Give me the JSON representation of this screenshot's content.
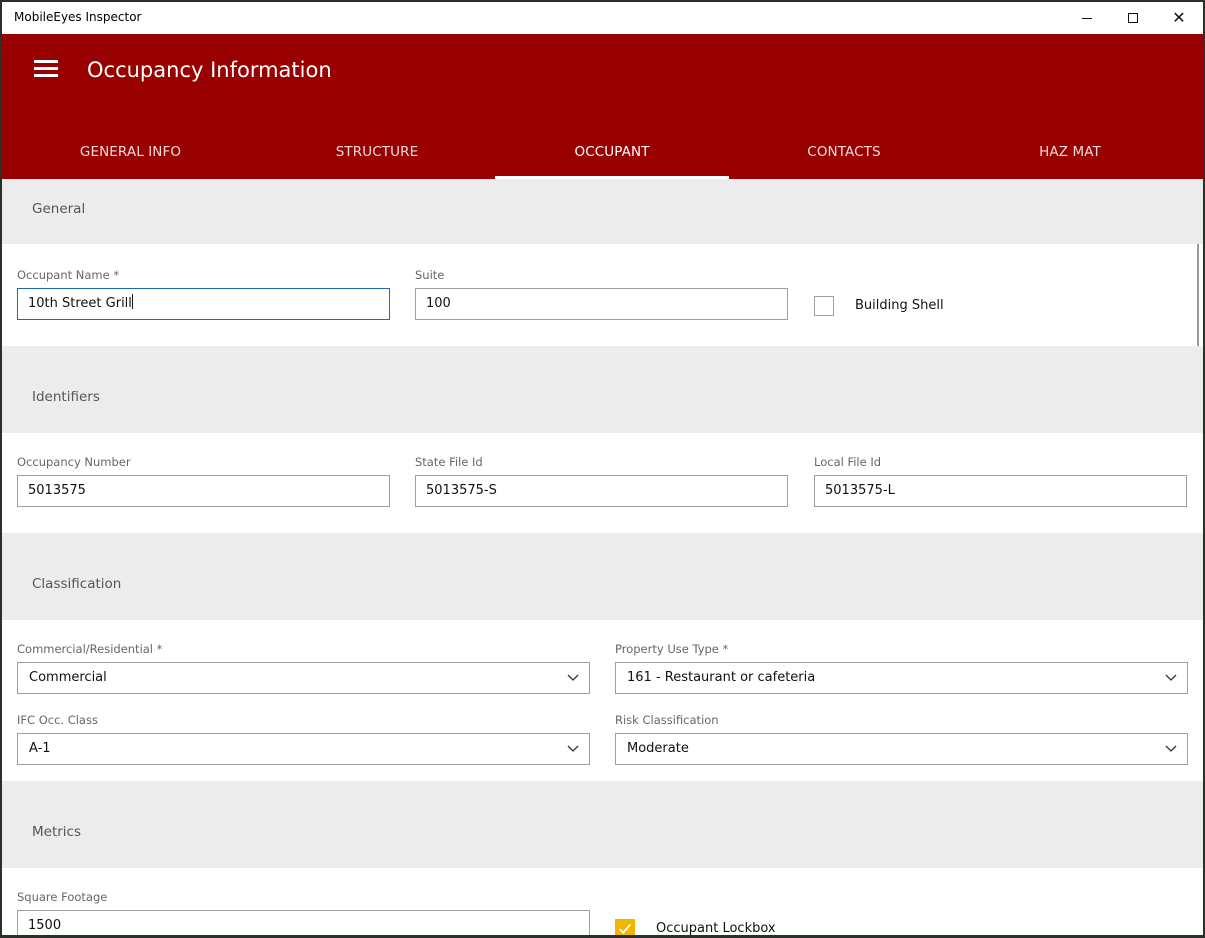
{
  "window": {
    "title": "MobileEyes Inspector",
    "minimize_icon": "minimize-icon",
    "maximize_icon": "maximize-icon",
    "close_icon": "close-icon"
  },
  "header": {
    "title": "Occupancy Information",
    "menu_icon": "hamburger-menu-icon",
    "background_color": "#990000",
    "tabs": [
      {
        "label": "GENERAL INFO",
        "active": false
      },
      {
        "label": "STRUCTURE",
        "active": false
      },
      {
        "label": "OCCUPANT",
        "active": true
      },
      {
        "label": "CONTACTS",
        "active": false
      },
      {
        "label": "HAZ MAT",
        "active": false
      }
    ]
  },
  "sections": {
    "general": {
      "title": "General",
      "occupant_name": {
        "label": "Occupant Name *",
        "value": "10th Street Grill"
      },
      "suite": {
        "label": "Suite",
        "value": "100"
      },
      "building_shell": {
        "label": "Building Shell",
        "checked": false
      }
    },
    "identifiers": {
      "title": "Identifiers",
      "occupancy_number": {
        "label": "Occupancy Number",
        "value": "5013575"
      },
      "state_file_id": {
        "label": "State File Id",
        "value": "5013575-S"
      },
      "local_file_id": {
        "label": "Local File Id",
        "value": "5013575-L"
      }
    },
    "classification": {
      "title": "Classification",
      "commercial_residential": {
        "label": "Commercial/Residential *",
        "value": "Commercial"
      },
      "property_use_type": {
        "label": "Property Use Type *",
        "value": "161 - Restaurant or cafeteria"
      },
      "ifc_occ_class": {
        "label": "IFC Occ. Class",
        "value": "A-1"
      },
      "risk_classification": {
        "label": "Risk Classification",
        "value": "Moderate"
      }
    },
    "metrics": {
      "title": "Metrics",
      "square_footage": {
        "label": "Square Footage",
        "value": "1500"
      },
      "occupant_lockbox": {
        "label": "Occupant Lockbox",
        "checked": true
      }
    }
  },
  "colors": {
    "accent": "#990000",
    "section_bg": "#ececec",
    "focus_border": "#1c6bb0",
    "checkbox_checked": "#f2b600"
  }
}
